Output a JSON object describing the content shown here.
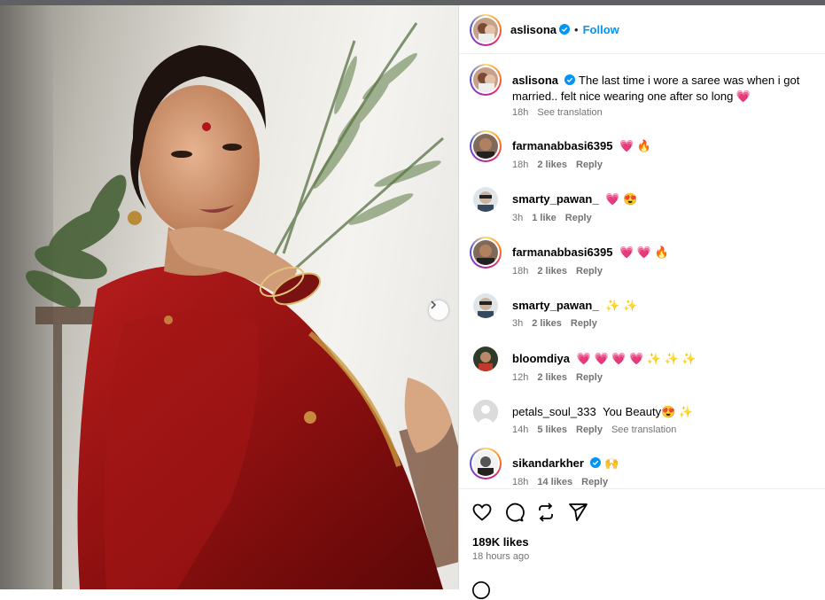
{
  "post": {
    "author": "aslisona",
    "follow_label": "Follow",
    "next_arrow": "chevron-right-icon"
  },
  "caption": {
    "user": "aslisona",
    "text": "The last time i wore a saree was when i got married.. felt nice wearing one after so long 💗",
    "time": "18h",
    "translate": "See translation"
  },
  "comments": [
    {
      "user": "farmanabbasi6395",
      "text": "💗 🔥",
      "time": "18h",
      "likes": "2 likes",
      "reply": "Reply"
    },
    {
      "user": "smarty_pawan_",
      "text": "💗 😍",
      "time": "3h",
      "likes": "1 like",
      "reply": "Reply"
    },
    {
      "user": "farmanabbasi6395",
      "text": "💗 💗 🔥",
      "time": "18h",
      "likes": "2 likes",
      "reply": "Reply"
    },
    {
      "user": "smarty_pawan_",
      "text": "✨ ✨",
      "time": "3h",
      "likes": "2 likes",
      "reply": "Reply"
    },
    {
      "user": "bloomdiya",
      "text": "💗 💗 💗 💗 ✨ ✨ ✨",
      "time": "12h",
      "likes": "2 likes",
      "reply": "Reply"
    },
    {
      "user": "petals_soul_333",
      "text": "You Beauty😍 ✨",
      "time": "14h",
      "likes": "5 likes",
      "reply": "Reply",
      "translate": "See translation"
    },
    {
      "user": "sikandarkher",
      "text": "🙌",
      "time": "18h",
      "likes": "14 likes",
      "reply": "Reply",
      "verified": true
    }
  ],
  "footer": {
    "likes": "189K likes",
    "ago": "18 hours ago"
  },
  "colors": {
    "accent": "#0095f6",
    "muted": "#737373",
    "heart": "#ed4956"
  }
}
